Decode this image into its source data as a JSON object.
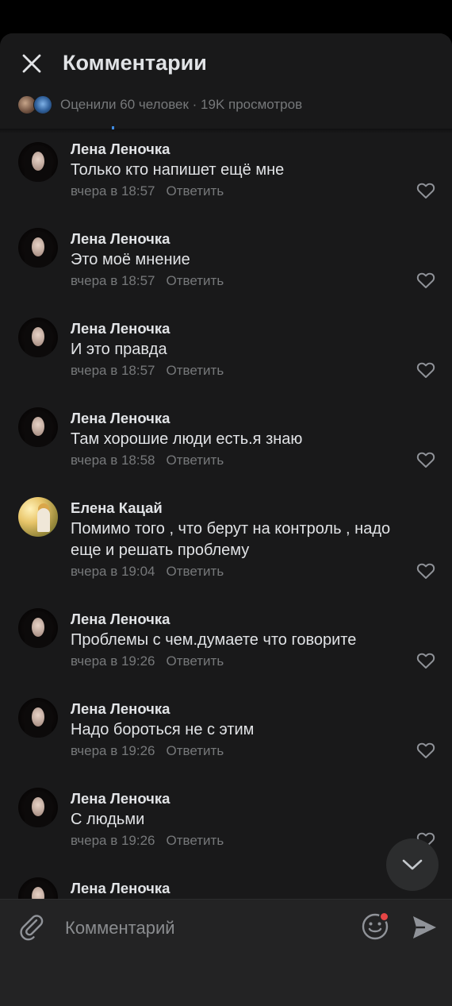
{
  "header": {
    "title": "Комментарии",
    "likes_text": "Оценили 60 человек · 19K просмотров"
  },
  "comments": [
    {
      "author": "Лена Леночка",
      "text": "Только кто напишет ещё мне",
      "time": "вчера в 18:57",
      "reply": "Ответить",
      "avatar": "woman-portrait"
    },
    {
      "author": "Лена Леночка",
      "text": "Это моё мнение",
      "time": "вчера в 18:57",
      "reply": "Ответить",
      "avatar": "woman-portrait"
    },
    {
      "author": "Лена Леночка",
      "text": "И это правда",
      "time": "вчера в 18:57",
      "reply": "Ответить",
      "avatar": "woman-portrait"
    },
    {
      "author": "Лена Леночка",
      "text": "Там хорошие люди есть.я знаю",
      "time": "вчера в 18:58",
      "reply": "Ответить",
      "avatar": "woman-portrait"
    },
    {
      "author": "Елена Кацай",
      "text": "Помимо того , что берут на контроль , надо еще и решать проблему",
      "time": "вчера в 19:04",
      "reply": "Ответить",
      "avatar": "outdoor-photo"
    },
    {
      "author": "Лена Леночка",
      "text": "Проблемы с чем.думаете что говорите",
      "time": "вчера в 19:26",
      "reply": "Ответить",
      "avatar": "woman-portrait"
    },
    {
      "author": "Лена Леночка",
      "text": "Надо бороться не с этим",
      "time": "вчера в 19:26",
      "reply": "Ответить",
      "avatar": "woman-portrait"
    },
    {
      "author": "Лена Леночка",
      "text": "С людьми",
      "time": "вчера в 19:26",
      "reply": "Ответить",
      "avatar": "woman-portrait"
    },
    {
      "author": "Лена Леночка",
      "text": "",
      "time": "",
      "reply": "",
      "avatar": "woman-portrait"
    }
  ],
  "composer": {
    "placeholder": "Комментарий"
  },
  "colors": {
    "background": "#19191a",
    "text_primary": "#e1e3e6",
    "text_secondary": "#76787a",
    "notification_dot": "#e64646",
    "accent": "#3f8ae0"
  },
  "icons": {
    "close": "close-icon",
    "heart": "heart-icon",
    "attach": "paperclip-icon",
    "emoji": "smile-icon",
    "send": "send-icon",
    "scroll": "chevron-down-icon"
  }
}
